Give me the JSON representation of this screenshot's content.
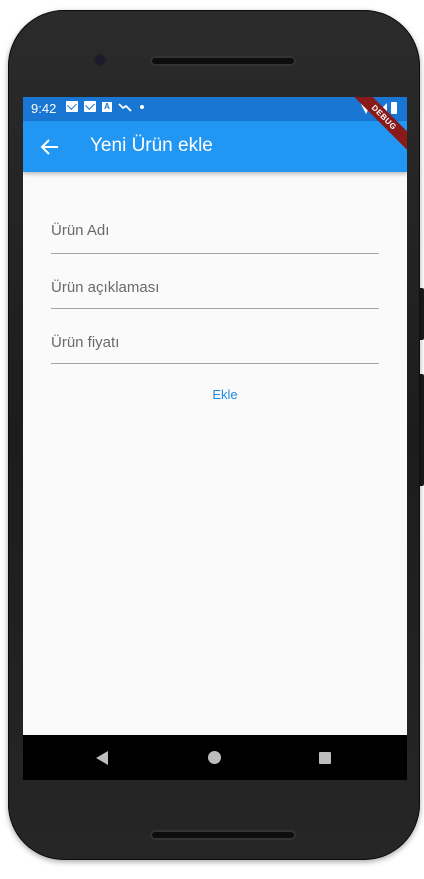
{
  "status_bar": {
    "time": "9:42",
    "icons": [
      "gmail-icon",
      "gmail-icon",
      "a-icon",
      "trend-icon",
      "dot-icon"
    ],
    "right_icons": [
      "wifi-icon",
      "signal-icon",
      "battery-icon"
    ]
  },
  "debug_banner": "DEBUG",
  "app_bar": {
    "title": "Yeni Ürün ekle",
    "back_icon": "arrow-back-icon",
    "color": "#2196f3"
  },
  "form": {
    "fields": [
      {
        "placeholder": "Ürün Adı",
        "value": ""
      },
      {
        "placeholder": "Ürün açıklaması",
        "value": ""
      },
      {
        "placeholder": "Ürün fiyatı",
        "value": ""
      }
    ],
    "submit_label": "Ekle"
  },
  "nav_bar": {
    "icons": [
      "nav-back-icon",
      "nav-home-icon",
      "nav-recents-icon"
    ]
  },
  "colors": {
    "status_bar": "#1976d2",
    "accent": "#1e88e5",
    "background": "#fafafa"
  }
}
